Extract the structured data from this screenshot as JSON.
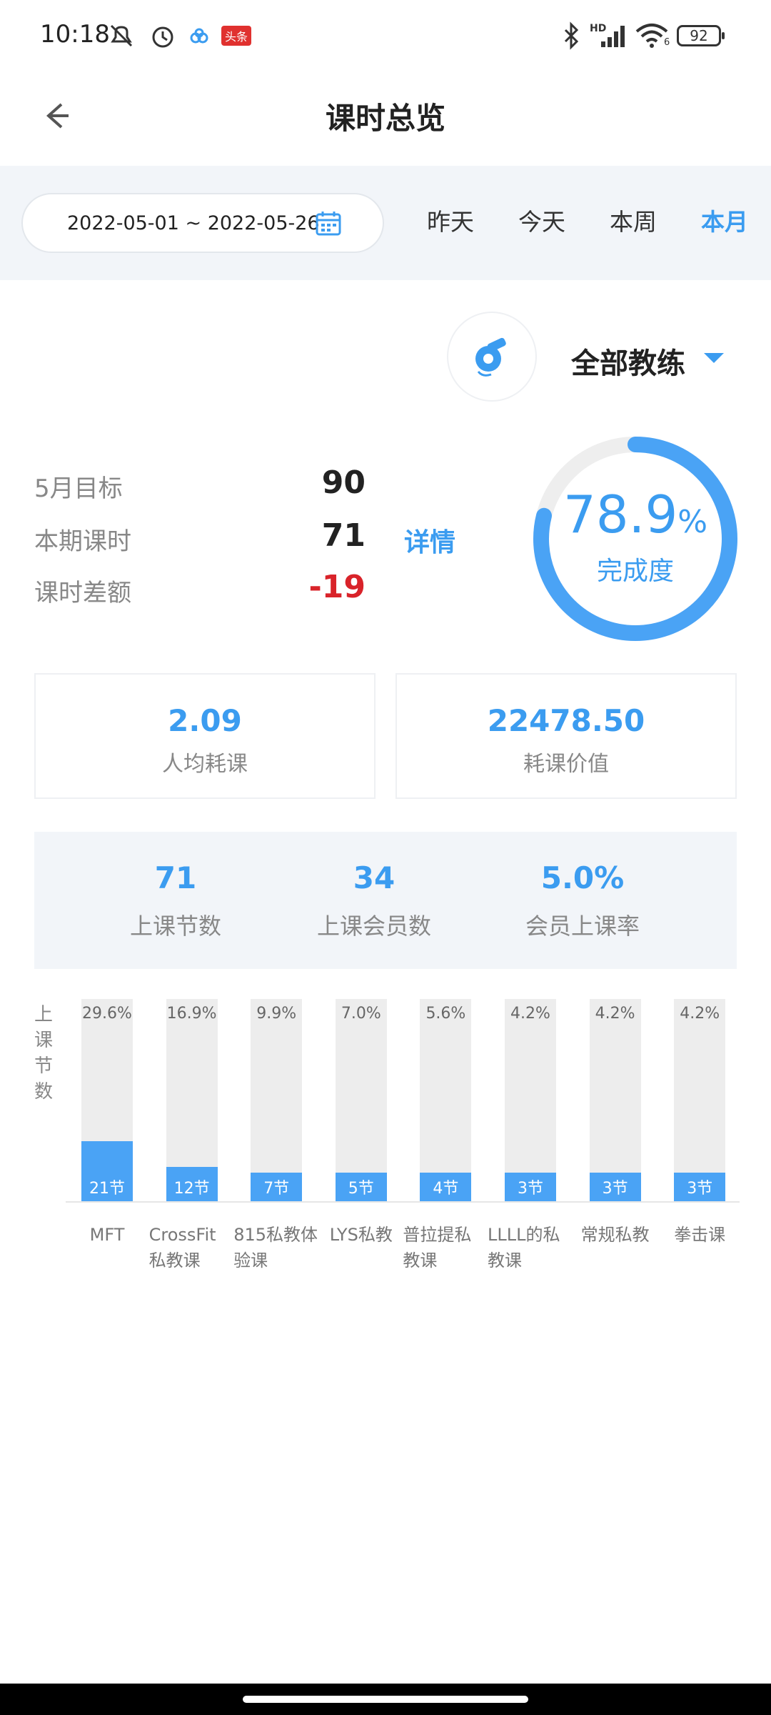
{
  "status": {
    "time": "10:18",
    "battery": "92",
    "badge": "头条",
    "network": "HD",
    "wifi_sub": "6",
    "icons": [
      "mute-icon",
      "alarm-icon",
      "cloud-icon",
      "bluetooth-icon",
      "signal-icon",
      "wifi-icon",
      "battery-icon"
    ]
  },
  "header": {
    "title": "课时总览"
  },
  "filter": {
    "date_range": "2022-05-01 ~ 2022-05-26",
    "tabs": [
      {
        "label": "昨天",
        "active": false
      },
      {
        "label": "今天",
        "active": false
      },
      {
        "label": "本周",
        "active": false
      },
      {
        "label": "本月",
        "active": true
      }
    ]
  },
  "coach": {
    "label": "全部教练"
  },
  "stats": [
    {
      "label": "5月目标",
      "value": "90"
    },
    {
      "label": "本期课时",
      "value": "71"
    },
    {
      "label": "课时差额",
      "value": "-19"
    }
  ],
  "detail_label": "详情",
  "completion": {
    "percent": "78.9",
    "symbol": "%",
    "label": "完成度",
    "fraction": 0.789
  },
  "cards": [
    {
      "value": "2.09",
      "label": "人均耗课"
    },
    {
      "value": "22478.50",
      "label": "耗课价值"
    }
  ],
  "summary": [
    {
      "value": "71",
      "label": "上课节数"
    },
    {
      "value": "34",
      "label": "上课会员数"
    },
    {
      "value": "5.0%",
      "label": "会员上课率"
    }
  ],
  "chart_data": {
    "type": "bar",
    "ylabel": "上课节数",
    "categories": [
      "MFT",
      "CrossFit私教课",
      "815私教体验课",
      "LYS私教",
      "普拉提私教课",
      "LLLL的私教课",
      "常规私教",
      "拳击课"
    ],
    "category_lines": [
      [
        "MFT"
      ],
      [
        "CrossFit",
        "私教课"
      ],
      [
        "815私教体",
        "验课"
      ],
      [
        "LYS私教"
      ],
      [
        "普拉提私",
        "教课"
      ],
      [
        "LLLL的私",
        "教课"
      ],
      [
        "常规私教"
      ],
      [
        "拳击课"
      ]
    ],
    "values": [
      21,
      12,
      7,
      5,
      4,
      3,
      3,
      3
    ],
    "value_labels": [
      "21节",
      "12节",
      "7节",
      "5节",
      "4节",
      "3节",
      "3节",
      "3节"
    ],
    "percent_labels": [
      "29.6%",
      "16.9%",
      "9.9%",
      "7.0%",
      "5.6%",
      "4.2%",
      "4.2%",
      "4.2%"
    ],
    "percents": [
      29.6,
      16.9,
      9.9,
      7.0,
      5.6,
      4.2,
      4.2,
      4.2
    ],
    "colors": {
      "bar": "#4aa3f5",
      "track": "#ededed"
    }
  },
  "colors": {
    "accent": "#3b9cf0",
    "negative": "#d9232a"
  }
}
